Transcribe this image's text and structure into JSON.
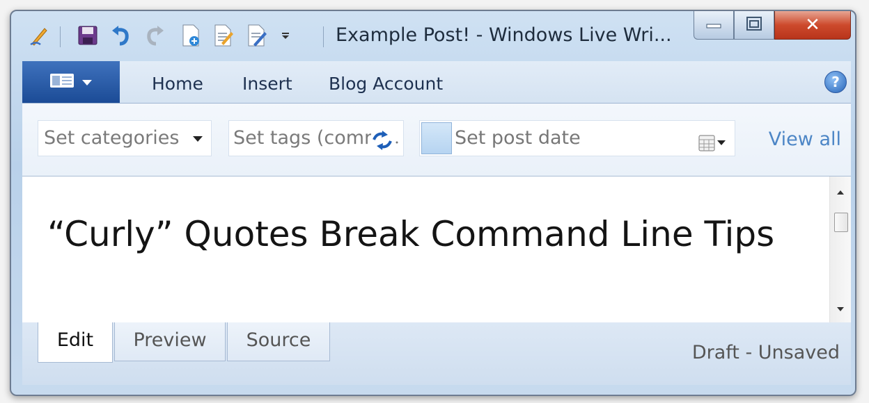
{
  "window": {
    "title": "Example Post! - Windows Live Wri...",
    "controls": {
      "minimize": "minimize",
      "maximize": "maximize",
      "close": "close"
    }
  },
  "quick_access": {
    "icons": [
      "pen-icon",
      "save-icon",
      "undo-icon",
      "redo-icon",
      "new-post-icon",
      "open-post-icon",
      "edit-post-icon",
      "customize-arrow-icon"
    ]
  },
  "ribbon": {
    "tabs": [
      {
        "label": "Home"
      },
      {
        "label": "Insert"
      },
      {
        "label": "Blog Account"
      }
    ]
  },
  "properties": {
    "categories": {
      "placeholder": "Set categories"
    },
    "tags": {
      "placeholder": "Set tags (comr"
    },
    "post_date": {
      "placeholder": "Set post date"
    },
    "view_all": "View all"
  },
  "editor": {
    "post_title": "“Curly” Quotes Break Command Line Tips"
  },
  "view_tabs": [
    {
      "label": "Edit",
      "active": true
    },
    {
      "label": "Preview",
      "active": false
    },
    {
      "label": "Source",
      "active": false
    }
  ],
  "status": "Draft - Unsaved",
  "colors": {
    "accent": "#1b4b96",
    "link": "#4d86c6",
    "close_button": "#cd4a2c",
    "window_frame": "#b9d1ea"
  }
}
